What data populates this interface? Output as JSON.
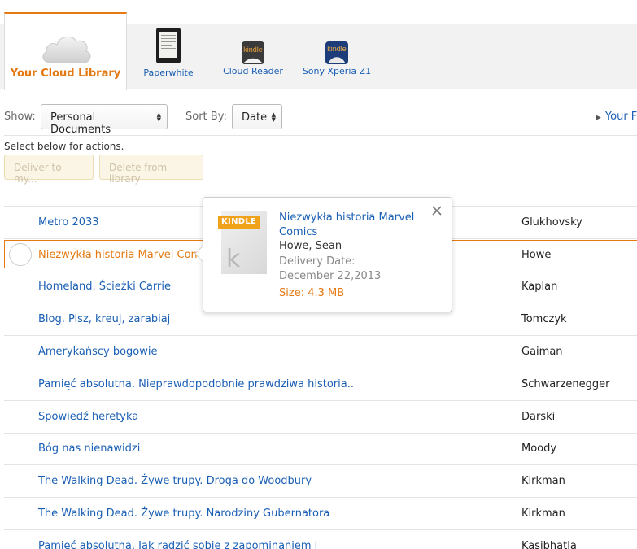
{
  "tabs": {
    "active": {
      "label": "Your Cloud Library"
    },
    "devices": [
      {
        "label": "Paperwhite"
      },
      {
        "label": "Cloud Reader"
      },
      {
        "label": "Sony Xperia Z1"
      }
    ],
    "kindle_word": "kindle"
  },
  "controls": {
    "show_label": "Show:",
    "show_value": "Personal Documents",
    "sort_label": "Sort By:",
    "sort_value": "Date",
    "right_link": "Your F"
  },
  "instruction": "Select below for actions.",
  "actions": {
    "deliver": "Deliver to my...",
    "delete": "Delete from library"
  },
  "items": [
    {
      "title": "Metro 2033",
      "author": "Glukhovsky"
    },
    {
      "title": "Niezwykła historia Marvel Comics",
      "author": "Howe"
    },
    {
      "title": "Homeland. Ścieżki Carrie",
      "author": "Kaplan"
    },
    {
      "title": "Blog. Pisz, kreuj, zarabiaj",
      "author": "Tomczyk"
    },
    {
      "title": "Amerykańscy bogowie",
      "author": "Gaiman"
    },
    {
      "title": "Pamięć absolutna. Nieprawdopodobnie prawdziwa historia..",
      "author": "Schwarzenegger"
    },
    {
      "title": "Spowiedź heretyka",
      "author": "Darski"
    },
    {
      "title": "Bóg nas nienawidzi",
      "author": "Moody"
    },
    {
      "title": "The Walking Dead. Żywe trupy. Droga do Woodbury",
      "author": "Kirkman"
    },
    {
      "title": "The Walking Dead. Żywe trupy. Narodziny Gubernatora",
      "author": "Kirkman"
    },
    {
      "title": "Pamięć absolutna. Jak radzić sobie z zapominaniem i",
      "author": "Kasibhatla"
    }
  ],
  "popover": {
    "badge": "KINDLE",
    "cover_letter": "k",
    "title": "Niezwykła historia Marvel Comics",
    "author": "Howe, Sean",
    "delivery": "Delivery Date: December 22,2013",
    "size": "Size: 4.3 MB"
  },
  "colors": {
    "accent": "#e47911",
    "link": "#1a5fb4",
    "badge": "#f0a21b"
  }
}
